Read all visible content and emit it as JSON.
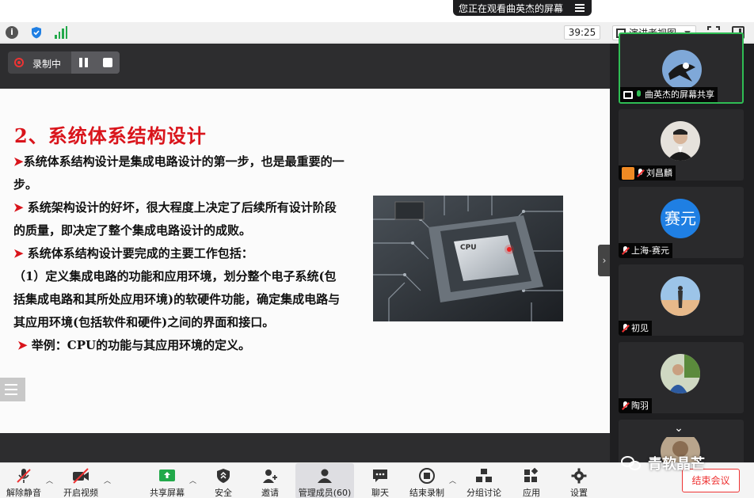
{
  "banner": {
    "text": "您正在观看曲英杰的屏幕"
  },
  "status": {
    "timer": "39:25",
    "view_mode": "演讲者视图"
  },
  "recording": {
    "label": "录制中"
  },
  "slide": {
    "title": "2、系统体系结构设计",
    "paragraphs": [
      {
        "arrow": "➤",
        "text": "系统体系结构设计是集成电路设计的第一步，也是最重要的一步。"
      },
      {
        "arrow": "➤",
        "text": " 系统架构设计的好坏，很大程度上决定了后续所有设计阶段的质量，即决定了整个集成电路设计的成败。"
      },
      {
        "arrow": "➤",
        "text": " 系统体系结构设计要完成的主要工作包括："
      },
      {
        "arrow": "",
        "text": "（1）定义集成电路的功能和应用环境，划分整个电子系统(包括集成电路和其所处应用环境)的软硬件功能，确定集成电路与其应用环境(包括软件和硬件)之间的界面和接口。"
      },
      {
        "arrow": "➤",
        "text": " 举例：CPU的功能与其应用环境的定义。"
      }
    ],
    "image_label": "CPU"
  },
  "participants": [
    {
      "name": "曲英杰的屏幕共享",
      "avatar": "eagle"
    },
    {
      "name": "刘昌麟",
      "avatar": "photo-man"
    },
    {
      "name": "上海-赛元",
      "avatar_text": "赛元"
    },
    {
      "name": "初见",
      "avatar": "photo-sky"
    },
    {
      "name": "陶羽",
      "avatar": "photo-person"
    },
    {
      "name": "",
      "avatar": "photo-partial"
    }
  ],
  "toolbar": {
    "unmute": "解除静音",
    "start_video": "开启视频",
    "share_screen": "共享屏幕",
    "security": "安全",
    "invite": "邀请",
    "manage": "管理成员(60)",
    "chat": "聊天",
    "end_recording": "结束录制",
    "breakout": "分组讨论",
    "apps": "应用",
    "settings": "设置",
    "end_meeting": "结束会议"
  },
  "watermark": "青软晶芒",
  "colors": {
    "accent_red": "#d9141b",
    "active_green": "#2fbd54",
    "avatar_blue": "#1f7fe3"
  }
}
